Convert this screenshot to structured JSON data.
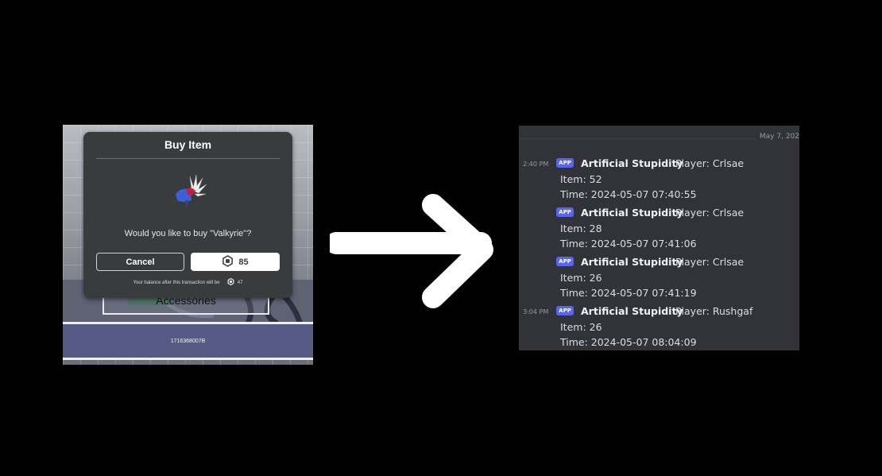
{
  "game": {
    "dialog": {
      "title": "Buy Item",
      "question": "Would you like to buy \"Valkyrie\"?",
      "cancel_label": "Cancel",
      "price": "85",
      "balance_text": "Your balance after this transaction will be",
      "balance_value": "47"
    },
    "accessories_label": "Accessories",
    "player_id": "1716368007B"
  },
  "discord": {
    "date_divider": "May 7, 202",
    "app_tag": "APP",
    "messages": [
      {
        "timestamp": "2:40 PM",
        "author": "Artificial Stupidity",
        "player": "Player: Crlsae",
        "item": "Item: 52",
        "time": "Time: 2024-05-07 07:40:55"
      },
      {
        "timestamp": "",
        "author": "Artificial Stupidity",
        "player": "Player: Crlsae",
        "item": "Item: 28",
        "time": "Time: 2024-05-07 07:41:06"
      },
      {
        "timestamp": "",
        "author": "Artificial Stupidity",
        "player": "Player: Crlsae",
        "item": "Item: 26",
        "time": "Time: 2024-05-07 07:41:19"
      },
      {
        "timestamp": "3:04 PM",
        "author": "Artificial Stupidity",
        "player": "Player: Rushgaf",
        "item": "Item: 26",
        "time": "Time: 2024-05-07 08:04:09"
      }
    ]
  },
  "icons": {
    "robux": "robux-icon",
    "item": "valkyrie-helm-icon",
    "arrow": "right-arrow-icon"
  }
}
